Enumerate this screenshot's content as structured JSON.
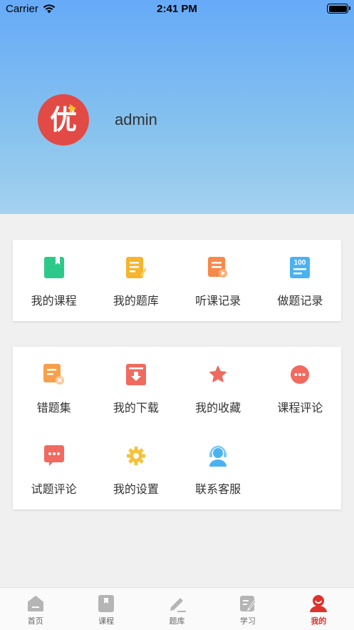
{
  "status_bar": {
    "carrier": "Carrier",
    "time": "2:41 PM"
  },
  "profile": {
    "avatar_char": "优",
    "username": "admin"
  },
  "quick_menu": [
    {
      "label": "我的课程",
      "icon": "course-book-icon",
      "color": "#2dc98a"
    },
    {
      "label": "我的题库",
      "icon": "question-bank-icon",
      "color": "#f6b52c"
    },
    {
      "label": "听课记录",
      "icon": "listen-record-icon",
      "color": "#f68a4b"
    },
    {
      "label": "做题记录",
      "icon": "exercise-record-icon",
      "color": "#4ab2f0"
    }
  ],
  "more_menu": [
    {
      "label": "错题集",
      "icon": "wrong-questions-icon",
      "color": "#f6a04b"
    },
    {
      "label": "我的下载",
      "icon": "download-icon",
      "color": "#f06a5f"
    },
    {
      "label": "我的收藏",
      "icon": "star-icon",
      "color": "#f06a5f"
    },
    {
      "label": "课程评论",
      "icon": "course-comment-icon",
      "color": "#f06a5f"
    },
    {
      "label": "试题评论",
      "icon": "question-comment-icon",
      "color": "#f06a5f"
    },
    {
      "label": "我的设置",
      "icon": "gear-icon",
      "color": "#f6c23c"
    },
    {
      "label": "联系客服",
      "icon": "customer-service-icon",
      "color": "#4ab2f0"
    }
  ],
  "tabs": [
    {
      "label": "首页",
      "icon": "home-icon"
    },
    {
      "label": "课程",
      "icon": "course-tab-icon"
    },
    {
      "label": "题库",
      "icon": "pencil-icon"
    },
    {
      "label": "学习",
      "icon": "study-icon"
    },
    {
      "label": "我的",
      "icon": "profile-icon",
      "active": true
    }
  ],
  "colors": {
    "accent": "#e0322c",
    "tab_inactive": "#b5b5b5"
  }
}
